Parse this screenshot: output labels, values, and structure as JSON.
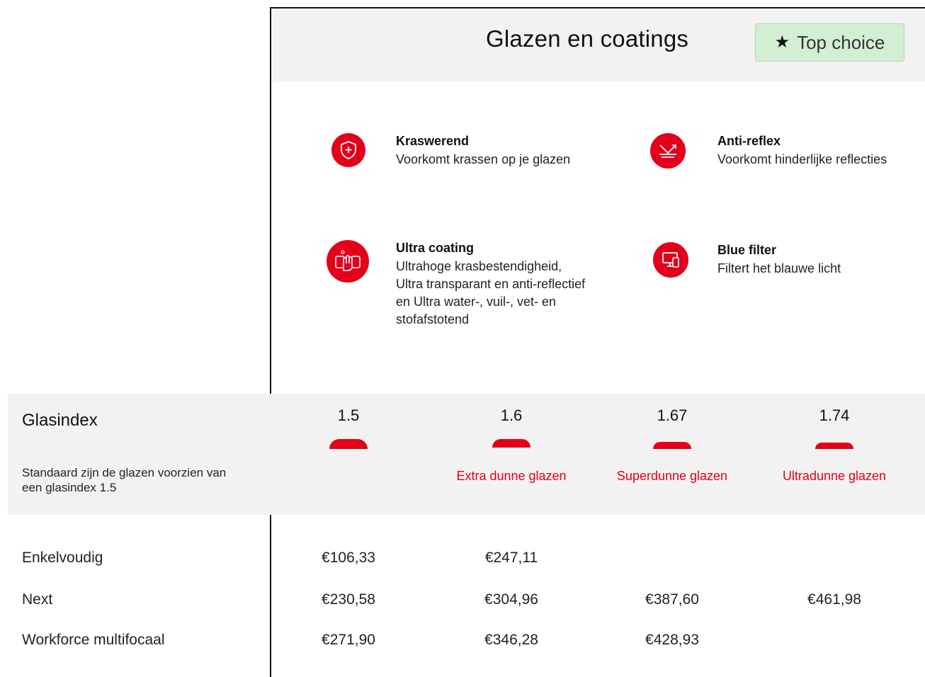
{
  "header": {
    "title": "Glazen en coatings",
    "top_choice_label": "Top choice"
  },
  "features": [
    {
      "icon": "shield-plus-icon",
      "title": "Kraswerend",
      "description": "Voorkomt krassen op je glazen"
    },
    {
      "icon": "anti-reflex-icon",
      "title": "Anti-reflex",
      "description": "Voorkomt hinderlijke reflecties"
    },
    {
      "icon": "ultra-coating-icon",
      "title": "Ultra coating",
      "description": "Ultrahoge krasbestendigheid, Ultra transparant en anti-reflectief en Ultra water-, vuil-, vet- en stofafstotend"
    },
    {
      "icon": "blue-filter-icon",
      "title": "Blue filter",
      "description": "Filtert het blauwe licht"
    }
  ],
  "glasindex": {
    "title": "Glasindex",
    "note": "Standaard zijn de glazen voorzien van een glasindex 1.5",
    "options": [
      {
        "value": "1.5",
        "label": ""
      },
      {
        "value": "1.6",
        "label": "Extra dunne glazen"
      },
      {
        "value": "1.67",
        "label": "Superdunne glazen"
      },
      {
        "value": "1.74",
        "label": "Ultradunne glazen"
      }
    ]
  },
  "prices": {
    "rows": [
      {
        "label": "Enkelvoudig",
        "values": [
          "€106,33",
          "€247,11",
          "",
          ""
        ]
      },
      {
        "label": "Next",
        "values": [
          "€230,58",
          "€304,96",
          "€387,60",
          "€461,98"
        ]
      },
      {
        "label": "Workforce multifocaal",
        "values": [
          "€271,90",
          "€346,28",
          "€428,93",
          ""
        ]
      }
    ]
  },
  "colors": {
    "accent": "#e2001a",
    "band": "#f2f2f2",
    "top_choice_bg": "#d3efd3"
  }
}
